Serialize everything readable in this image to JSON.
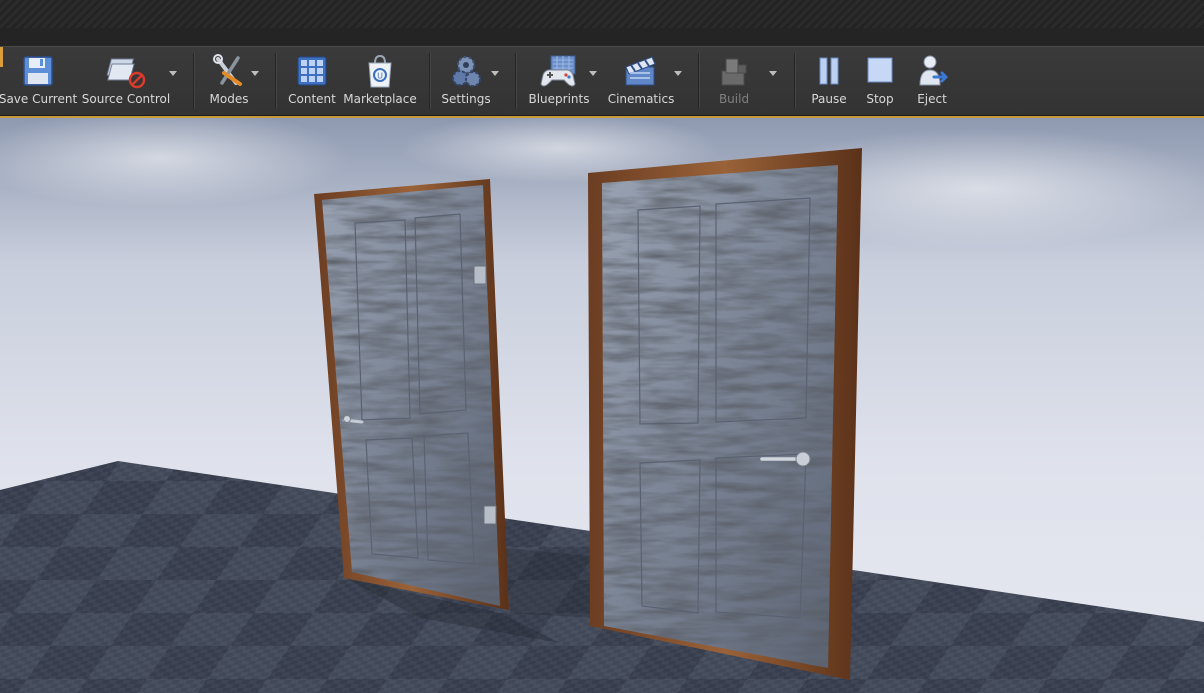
{
  "toolbar": {
    "save_current": "Save Current",
    "source_control": "Source Control",
    "modes": "Modes",
    "content": "Content",
    "marketplace": "Marketplace",
    "settings": "Settings",
    "blueprints": "Blueprints",
    "cinematics": "Cinematics",
    "build": "Build",
    "pause": "Pause",
    "stop": "Stop",
    "eject": "Eject"
  },
  "icons": {
    "save_current": "floppy-disk-icon",
    "source_control": "source-control-icon",
    "modes": "modes-tools-icon",
    "content": "content-grid-icon",
    "marketplace": "marketplace-bag-icon",
    "settings": "settings-gears-icon",
    "blueprints": "blueprints-gamepad-icon",
    "cinematics": "clapperboard-icon",
    "build": "build-blocks-icon",
    "pause": "pause-icon",
    "stop": "stop-icon",
    "eject": "eject-person-icon"
  },
  "colors": {
    "toolbar_bg": "#363636",
    "accent": "#d9a03a",
    "label": "#d8d8d8",
    "label_disabled": "#808080"
  }
}
